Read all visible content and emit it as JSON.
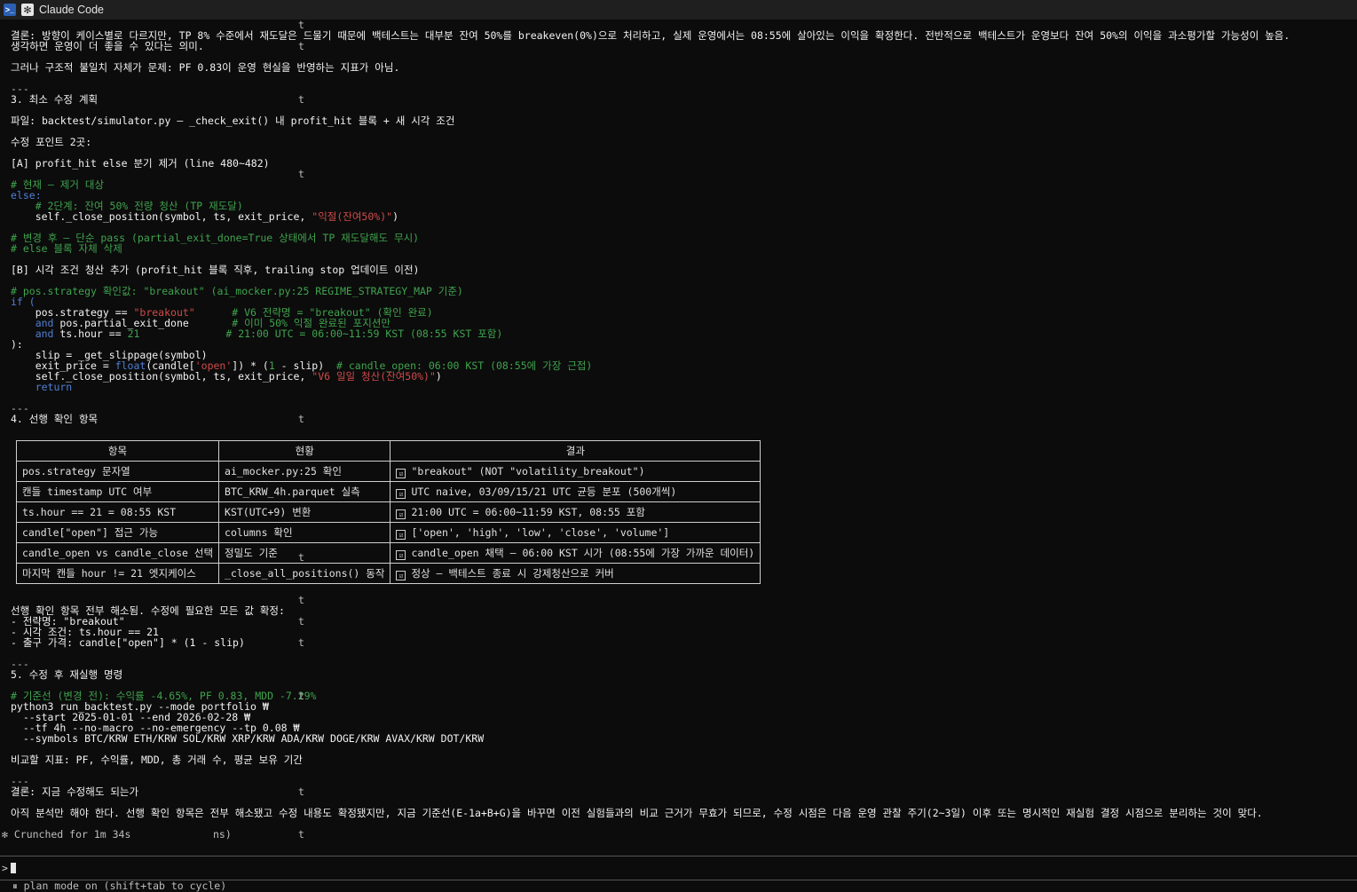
{
  "window": {
    "title": "Claude Code"
  },
  "lines": {
    "l1": "결론: 방향이 케이스별로 다르지만, TP 8% 수준에서 재도달은 드물기 때문에 백테스트는 대부분 잔여 50%를 breakeven(0%)으로 처리하고, 실제 운영에서는 08:55에 살아있는 이익을 확정한다. 전반적으로 백테스트가 운영보다 잔여 50%의 이익을 과소평가할 가능성이 높음.",
    "l2": "생각하면 운영이 더 좋을 수 있다는 의미.",
    "l3": "그러나 구조적 불일치 자체가 문제: PF 0.83이 운영 현실을 반영하는 지표가 아님.",
    "sep1": "---",
    "h3": "3. 최소 수정 계획",
    "file": "파일: backtest/simulator.py — _check_exit() 내 profit_hit 블록 + 새 시각 조건",
    "points": "수정 포인트 2곳:",
    "a": "[A] profit_hit else 분기 제거 (line 480~482)",
    "c1": "# 현재 — 제거 대상",
    "c2": "else:",
    "c3": "    # 2단계: 잔여 50% 전량 청산 (TP 재도달)",
    "c4a": "    self._close_position(symbol, ts, exit_price, ",
    "c4b": "\"익절(잔여50%)\"",
    "c4c": ")",
    "c5": "# 변경 후 — 단순 pass (partial_exit_done=True 상태에서 TP 재도달해도 무시)",
    "c6": "# else 블록 자체 삭제",
    "b": "[B] 시각 조건 청산 추가 (profit_hit 블록 직후, trailing stop 업데이트 이전)",
    "d1": "# pos.strategy 확인값: \"breakout\" (ai_mocker.py:25 REGIME_STRATEGY_MAP 기준)",
    "d2": "if (",
    "d3a": "    pos.strategy == ",
    "d3b": "\"breakout\"",
    "d3c": "      # V6 전략명 = \"breakout\" (확인 완료)",
    "d4a": "    and",
    "d4b": " pos.partial_exit_done",
    "d4c": "       # 이미 50% 익절 완료된 포지션만",
    "d5a": "    and",
    "d5b": " ts.hour == ",
    "d5c": "21",
    "d5d": "              # 21:00 UTC = 06:00~11:59 KST (08:55 KST 포함)",
    "d6": "):",
    "d7": "    slip = _get_slippage(symbol)",
    "d8a": "    exit_price = ",
    "d8b": "float",
    "d8c": "(candle[",
    "d8d": "'open'",
    "d8e": "]) * (",
    "d8f": "1",
    "d8g": " - slip)  ",
    "d8h": "# candle_open: 06:00 KST (08:55에 가장 근접)",
    "d9a": "    self._close_position(symbol, ts, exit_price, ",
    "d9b": "\"V6 일일 청산(잔여50%)\"",
    "d9c": ")",
    "d10": "    return",
    "sep2": "---",
    "h4": "4. 선행 확인 항목",
    "after1": "선행 확인 항목 전부 해소됨. 수정에 필요한 모든 값 확정:",
    "after2": "- 전략명: \"breakout\"",
    "after3": "- 시각 조건: ts.hour == 21",
    "after4": "- 출구 가격: candle[\"open\"] * (1 - slip)",
    "sep3": "---",
    "h5": "5. 수정 후 재실행 명령",
    "e1": "# 기준선 (변경 전): 수익률 -4.65%, PF 0.83, MDD -7.29%",
    "e2": "python3 run_backtest.py --mode portfolio ₩",
    "e3": "  --start 2025-01-01 --end 2026-02-28 ₩",
    "e4": "  --tf 4h --no-macro --no-emergency --tp 0.08 ₩",
    "e5": "  --symbols BTC/KRW ETH/KRW SOL/KRW XRP/KRW ADA/KRW DOGE/KRW AVAX/KRW DOT/KRW",
    "cmp": "비교할 지표: PF, 수익률, MDD, 총 거래 수, 평균 보유 기간",
    "sep4": "---",
    "concl": "결론: 지금 수정해도 되는가",
    "final": "아직 분석만 해야 한다. 선행 확인 항목은 전부 해소됐고 수정 내용도 확정됐지만, 지금 기준선(E-1a+B+G)을 바꾸면 이전 실험들과의 비교 근거가 무효가 되므로, 수정 시점은 다음 운영 관찰 주기(2~3일) 이후 또는 명시적인 재실험 결정 시점으로 분리하는 것이 맞다.",
    "status_a": "✻ Crunched for 1m 34s",
    "status_b": "ns)",
    "t": "t",
    "footer": "⏸ plan mode on (shift+tab to cycle)"
  },
  "table": {
    "headers": [
      "항목",
      "현황",
      "결과"
    ],
    "rows": [
      [
        "pos.strategy 문자열",
        "ai_mocker.py:25 확인",
        "\"breakout\" (NOT \"volatility_breakout\")"
      ],
      [
        "캔들 timestamp UTC 여부",
        "BTC_KRW_4h.parquet 실측",
        "UTC naive, 03/09/15/21 UTC 균등 분포 (500개씩)"
      ],
      [
        "ts.hour == 21 = 08:55 KST",
        "KST(UTC+9) 변환",
        "21:00 UTC = 06:00~11:59 KST, 08:55 포함"
      ],
      [
        "candle[\"open\"] 접근 가능",
        "columns 확인",
        "['open', 'high', 'low', 'close', 'volume']"
      ],
      [
        "candle_open vs candle_close 선택",
        "정밀도 기준",
        "candle_open 채택 — 06:00 KST 시가 (08:55에 가장 가까운 데이터)"
      ],
      [
        "마지막 캔들 hour != 21 엣지케이스",
        "_close_all_positions() 동작",
        "정상 — 백테스트 종료 시 강제청산으로 커버"
      ]
    ],
    "check": "☑"
  },
  "prompt": {
    "caret": ">"
  }
}
